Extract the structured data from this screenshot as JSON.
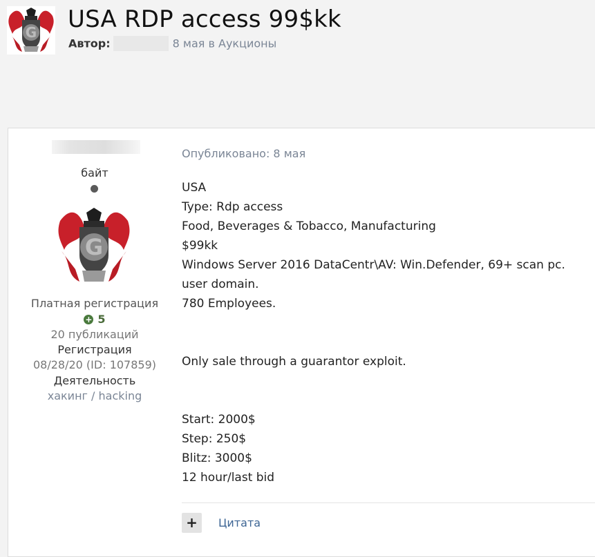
{
  "header": {
    "title": "USA RDP access 99$kk",
    "author_label": "Автор:",
    "author_name": "",
    "date_section": "8 мая в Аукционы",
    "avatar_icon": "coat-of-arms-avatar"
  },
  "author": {
    "name": "",
    "rank": "байт",
    "status": "offline",
    "group": "Платная регистрация",
    "reputation": "5",
    "posts_count": "20 публикаций",
    "registration_label": "Регистрация",
    "registration_value": "08/28/20 (ID: 107859)",
    "activity_label": "Деятельность",
    "activity_value": "хакинг / hacking"
  },
  "post": {
    "published": "Опубликовано: 8 мая",
    "lines": [
      "USA",
      "Type: Rdp access",
      "Food, Beverages & Tobacco, Manufacturing",
      "$99kk",
      "Windows Server 2016 DataCentr\\AV: Win.Defender, 69+ scan pc.",
      "user domain.",
      "780 Employees.",
      "",
      "",
      "Only sale through a guarantor exploit.",
      "",
      "",
      "Start: 2000$",
      "Step: 250$",
      "Blitz: 3000$",
      "12 hour/last bid"
    ],
    "multiquote_label": "+",
    "quote_label": "Цитата"
  },
  "colors": {
    "accent_link": "#3d6594",
    "muted": "#7a8595",
    "reputation": "#4a7a3d",
    "page_bg": "#f3f3f3"
  }
}
